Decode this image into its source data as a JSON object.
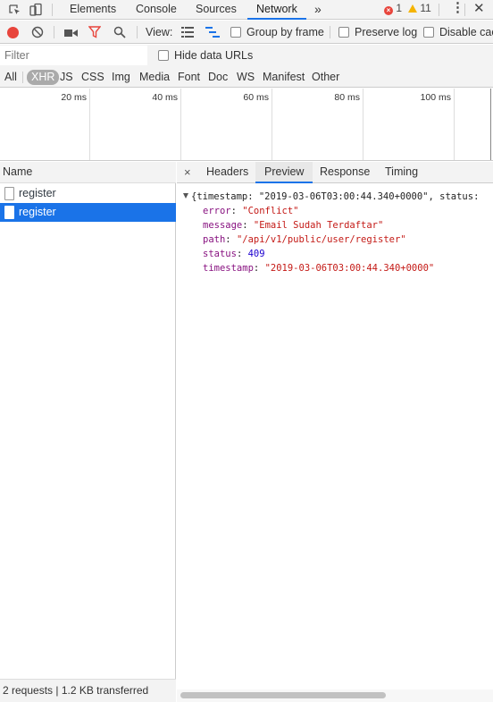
{
  "devtools_tabs": [
    "Elements",
    "Console",
    "Sources",
    "Network"
  ],
  "active_tab": "Network",
  "more_tabs": "»",
  "error_count": "1",
  "warning_count": "11",
  "toolbar": {
    "view_label": "View:",
    "group_by_frame": "Group by frame",
    "preserve_log": "Preserve log",
    "disable_cache": "Disable cac"
  },
  "filter": {
    "placeholder": "Filter",
    "hide_data_urls": "Hide data URLs"
  },
  "resource_types": [
    "All",
    "XHR",
    "JS",
    "CSS",
    "Img",
    "Media",
    "Font",
    "Doc",
    "WS",
    "Manifest",
    "Other"
  ],
  "active_type": "XHR",
  "timeline_ticks": [
    "20 ms",
    "40 ms",
    "60 ms",
    "80 ms",
    "100 ms"
  ],
  "requests": {
    "header": "Name",
    "items": [
      "register",
      "register"
    ],
    "selected_index": 1,
    "summary": "2 requests | 1.2 KB transferred"
  },
  "detail": {
    "close": "×",
    "tabs": [
      "Headers",
      "Preview",
      "Response",
      "Timing"
    ],
    "active_tab": "Preview",
    "preview": {
      "summary_line": "{timestamp: \"2019-03-06T03:00:44.340+0000\", status:",
      "fields": [
        {
          "key": "error",
          "value": "\"Conflict\"",
          "kind": "string"
        },
        {
          "key": "message",
          "value": "\"Email Sudah Terdaftar\"",
          "kind": "string"
        },
        {
          "key": "path",
          "value": "\"/api/v1/public/user/register\"",
          "kind": "string"
        },
        {
          "key": "status",
          "value": "409",
          "kind": "number"
        },
        {
          "key": "timestamp",
          "value": "\"2019-03-06T03:00:44.340+0000\"",
          "kind": "string"
        }
      ]
    }
  },
  "colors": {
    "accent": "#1a73e8",
    "json_key": "#881280",
    "json_string": "#c41a16",
    "json_number": "#1c00cf",
    "record_red": "#e8453c"
  }
}
